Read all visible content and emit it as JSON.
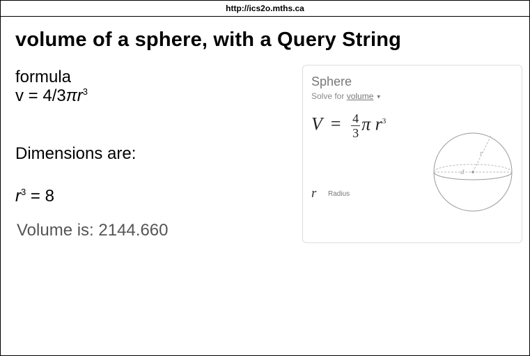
{
  "url": "http://ics2o.mths.ca",
  "page": {
    "title": "volume of a sphere, with a Query String",
    "formula_label": "formula",
    "formula_prefix": "v = 4/3",
    "formula_pi": "π",
    "formula_r": "r",
    "formula_exp": "3",
    "dimensions_heading": "Dimensions are:",
    "radius_var": "r",
    "radius_exp": "3",
    "radius_value": " = 8",
    "volume_text": "Volume is: 2144.660"
  },
  "card": {
    "title": "Sphere",
    "solve_prefix": "Solve for ",
    "solve_link": "volume",
    "eq_lhs": "V",
    "eq_equals": "=",
    "eq_num": "4",
    "eq_den": "3",
    "eq_pi": "π",
    "eq_r": "r",
    "eq_exp": "3",
    "var_symbol": "r",
    "var_label": "Radius",
    "diagram_r": "r",
    "diagram_d": "d"
  }
}
